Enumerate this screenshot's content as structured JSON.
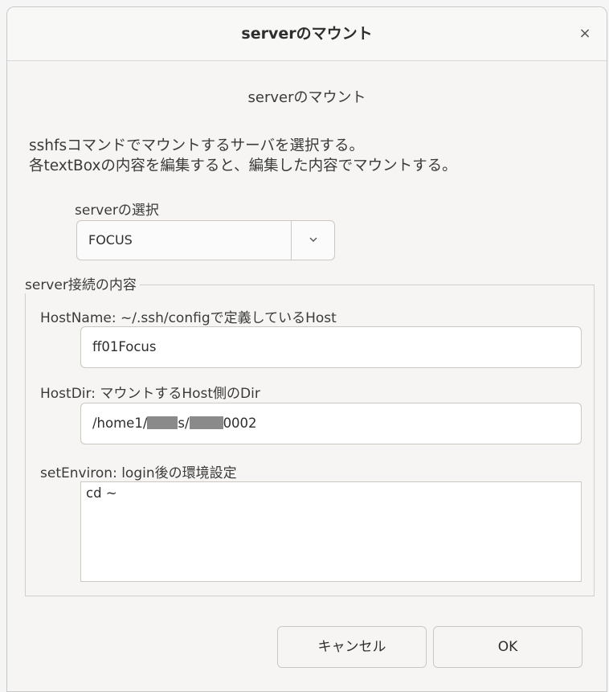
{
  "dialog": {
    "title": "serverのマウント",
    "close_glyph": "×",
    "heading": "serverのマウント",
    "description_line1": "sshfsコマンドでマウントするサーバを選択する。",
    "description_line2": "各textBoxの内容を編集すると、編集した内容でマウントする。"
  },
  "server_select": {
    "label": "serverの選択",
    "value": "FOCUS",
    "dropdown_glyph": "﹀",
    "icon": "chevron-down-icon"
  },
  "connection": {
    "legend": "server接続の内容",
    "hostname_label": "HostName:  ~/.ssh/configで定義しているHost",
    "hostname_value": "ff01Focus",
    "hostdir_label": "HostDir:  マウントするHost側のDir",
    "hostdir_prefix": "/home1/",
    "hostdir_seg1_tail": "s/",
    "hostdir_seg2_tail": "0002",
    "setenv_label": "setEnviron:  login後の環境設定",
    "setenv_value": "cd ~"
  },
  "buttons": {
    "cancel": "キャンセル",
    "ok": "OK"
  }
}
